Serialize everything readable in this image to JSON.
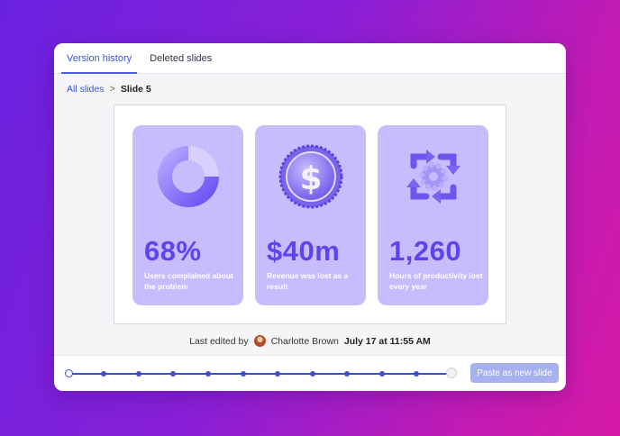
{
  "tabs": [
    {
      "label": "Version history",
      "active": true
    },
    {
      "label": "Deleted slides",
      "active": false
    }
  ],
  "breadcrumb": {
    "parent": "All slides",
    "separator": ">",
    "current": "Slide 5"
  },
  "cards": [
    {
      "icon": "donut-chart-icon",
      "value": "68%",
      "description": "Users complained about the problem"
    },
    {
      "icon": "dollar-coin-icon",
      "value": "$40m",
      "description": "Revenue was lost as a result"
    },
    {
      "icon": "gear-refresh-icon",
      "value": "1,260",
      "description": "Hours of productivity lost every year"
    }
  ],
  "edited": {
    "prefix": "Last edited by",
    "author": "Charlotte Brown",
    "date": "July 17 at 11:55 AM"
  },
  "timeline": {
    "versions": 12,
    "selected_index": 11
  },
  "paste_button_label": "Paste as new slide",
  "colors": {
    "accent": "#3a55d8",
    "card_bg": "#c8bcff",
    "value_color": "#5d44ee",
    "button_bg": "#a7b1f0"
  }
}
